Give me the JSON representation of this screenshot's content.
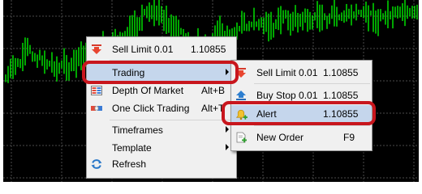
{
  "context_menu": {
    "sell_limit": {
      "label": "Sell Limit 0.01",
      "value": "1.10855"
    },
    "trading": {
      "label": "Trading"
    },
    "depth_of_market": {
      "label": "Depth Of Market",
      "shortcut": "Alt+B"
    },
    "one_click_trading": {
      "label": "One Click Trading",
      "shortcut": "Alt+T"
    },
    "timeframes": {
      "label": "Timeframes"
    },
    "template": {
      "label": "Template"
    },
    "refresh": {
      "label": "Refresh"
    }
  },
  "trading_submenu": {
    "sell_limit": {
      "label": "Sell Limit 0.01",
      "value": "1.10855"
    },
    "buy_stop": {
      "label": "Buy Stop 0.01",
      "value": "1.10855"
    },
    "alert": {
      "label": "Alert",
      "value": "1.10855"
    },
    "new_order": {
      "label": "New Order",
      "shortcut": "F9"
    }
  },
  "icons": {
    "sell_limit": "red-down-arrow-icon",
    "buy_stop": "blue-up-arrow-icon",
    "alert": "bell-icon",
    "depth_of_market": "depth-of-market-icon",
    "one_click_trading": "one-click-trading-icon",
    "refresh": "refresh-icon",
    "new_order": "new-order-icon"
  },
  "colors": {
    "chart_background": "#000000",
    "candle": "#00ff00",
    "grid": "#4a4a4a",
    "highlight": "#c5d6ec",
    "callout": "#c8161d"
  }
}
